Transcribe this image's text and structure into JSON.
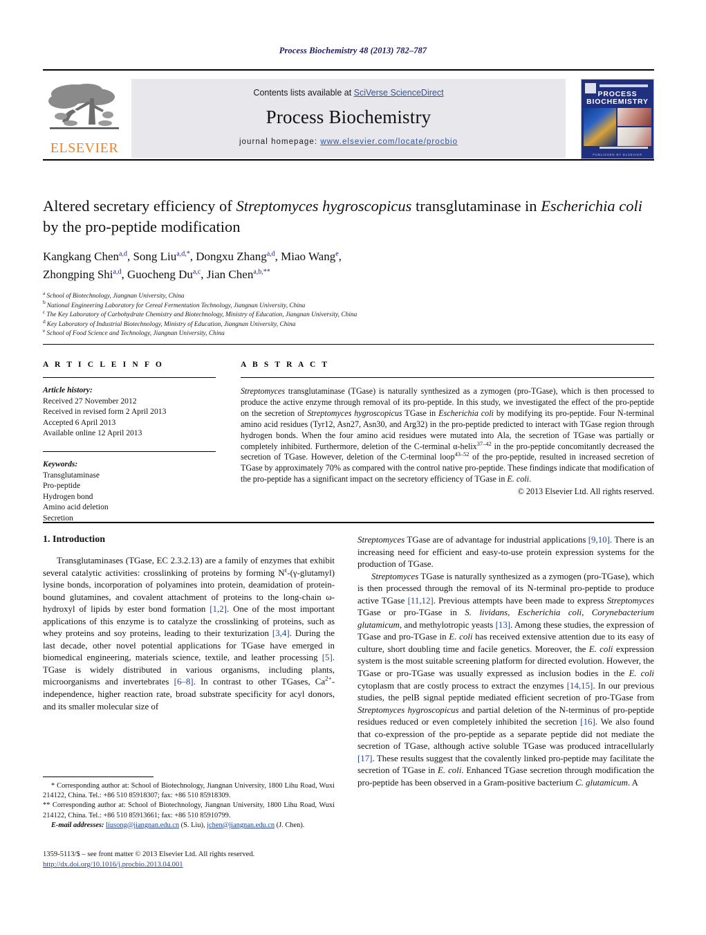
{
  "running_head": "Process Biochemistry 48 (2013) 782–787",
  "masthead": {
    "contents_prefix": "Contents lists available at ",
    "contents_link": "SciVerse ScienceDirect",
    "journal_title": "Process Biochemistry",
    "homepage_prefix": "journal homepage: ",
    "homepage_url": "www.elsevier.com/locate/procbio",
    "publisher_wordmark": "ELSEVIER",
    "cover_title": "PROCESS BIOCHEMISTRY",
    "cover_footer": "PUBLISHED BY ELSEVIER",
    "link_color": "#2e54a1",
    "band_color": "#e8e8ec",
    "elsevier_orange": "#f58220",
    "cover_blue": "#21307e"
  },
  "article": {
    "title_line1_a": "Altered secretary efficiency of ",
    "title_line1_i": "Streptomyces hygroscopicus",
    "title_line1_b": " transglutaminase in",
    "title_line2_i": "Escherichia coli",
    "title_line2_b": " by the pro-peptide modification",
    "authors": [
      {
        "name": "Kangkang Chen",
        "sup": "a,d",
        "sep": ", "
      },
      {
        "name": "Song Liu",
        "sup": "a,d,*",
        "sep": ", "
      },
      {
        "name": "Dongxu Zhang",
        "sup": "a,d",
        "sep": ", "
      },
      {
        "name": "Miao Wang",
        "sup": "e",
        "sep": ","
      },
      {
        "name": "Zhongping Shi",
        "sup": "a,d",
        "sep": ", "
      },
      {
        "name": "Guocheng Du",
        "sup": "a,c",
        "sep": ", "
      },
      {
        "name": "Jian Chen",
        "sup": "a,b,**",
        "sep": ""
      }
    ],
    "affiliations": [
      {
        "mark": "a",
        "text": "School of Biotechnology, Jiangnan University, China"
      },
      {
        "mark": "b",
        "text": "National Engineering Laboratory for Cereal Fermentation Technology, Jiangnan University, China"
      },
      {
        "mark": "c",
        "text": "The Key Laboratory of Carbohydrate Chemistry and Biotechnology, Ministry of Education, Jiangnan University, China"
      },
      {
        "mark": "d",
        "text": "Key Laboratory of Industrial Biotechnology, Ministry of Education, Jiangnan University, China"
      },
      {
        "mark": "e",
        "text": "School of Food Science and Technology, Jiangnan University, China"
      }
    ]
  },
  "article_info": {
    "heading": "A R T I C L E   I N F O",
    "history_label": "Article history:",
    "history": [
      "Received 27 November 2012",
      "Received in revised form 2 April 2013",
      "Accepted 6 April 2013",
      "Available online 12 April 2013"
    ],
    "keywords_label": "Keywords:",
    "keywords": [
      "Transglutaminase",
      "Pro-peptide",
      "Hydrogen bond",
      "Amino acid deletion",
      "Secretion"
    ]
  },
  "abstract": {
    "heading": "A B S T R A C T",
    "p1_i1": "Streptomyces",
    "p1_t1": " transglutaminase (TGase) is naturally synthesized as a zymogen (pro-TGase), which is then processed to produce the active enzyme through removal of its pro-peptide. In this study, we investigated the effect of the pro-peptide on the secretion of ",
    "p1_i2": "Streptomyces hygroscopicus",
    "p1_t2": " TGase in ",
    "p1_i3": "Escherichia coli",
    "p1_t3": " by modifying its pro-peptide. Four N-terminal amino acid residues (Tyr12, Asn27, Asn30, and Arg32) in the pro-peptide predicted to interact with TGase region through hydrogen bonds. When the four amino acid residues were mutated into Ala, the secretion of TGase was partially or completely inhibited. Furthermore, deletion of the C-terminal α-helix",
    "p1_sup1": "37–42",
    "p1_t4": " in the pro-peptide concomitantly decreased the secretion of TGase. However, deletion of the C-terminal loop",
    "p1_sup2": "43–52",
    "p1_t5": " of the pro-peptide, resulted in increased secretion of TGase by approximately 70% as compared with the control native pro-peptide. These findings indicate that modification of the pro-peptide has a significant impact on the secretory efficiency of TGase in ",
    "p1_i4": "E. coli",
    "p1_t6": ".",
    "copyright": "© 2013 Elsevier Ltd. All rights reserved."
  },
  "introduction": {
    "heading": "1.  Introduction",
    "left_p1_a": "Transglutaminases (TGase, EC 2.3.2.13) are a family of enzymes that exhibit several catalytic activities: crosslinking of proteins by forming N",
    "left_p1_sup": "ε",
    "left_p1_b": "-(γ-glutamyl) lysine bonds, incorporation of polyamines into protein, deamidation of protein-bound glutamines, and covalent attachment of proteins to the long-chain ω-hydroxyl of lipids by ester bond formation ",
    "left_ref_12": "[1,2]",
    "left_p1_c": ". One of the most important applications of this enzyme is to catalyze the crosslinking of proteins, such as whey proteins and soy proteins, leading to their texturization ",
    "left_ref_34": "[3,4]",
    "left_p1_d": ". During the last decade, other novel potential applications for TGase have emerged in biomedical engineering, materials science, textile, and leather processing ",
    "left_ref_5": "[5]",
    "left_p1_e": ". TGase is widely distributed in various organisms, including plants, microorganisms and invertebrates ",
    "left_ref_68": "[6–8]",
    "left_p1_f": ". In contrast to other TGases, Ca",
    "left_p1_sup2": "2+",
    "left_p1_g": "-independence, higher reaction rate, broad substrate specificity for acyl donors, and its smaller molecular size of",
    "right_p1_i": "Streptomyces",
    "right_p1_a": " TGase are of advantage for industrial applications ",
    "right_ref_910": "[9,10]",
    "right_p1_b": ". There is an increasing need for efficient and easy-to-use protein expression systems for the production of TGase.",
    "right_p2_i1": "Streptomyces",
    "right_p2_a": " TGase is naturally synthesized as a zymogen (pro-TGase), which is then processed through the removal of its N-terminal pro-peptide to produce active TGase ",
    "right_ref_1112": "[11,12]",
    "right_p2_b": ". Previous attempts have been made to express ",
    "right_p2_i2": "Streptomyces",
    "right_p2_c": " TGase or pro-TGase in ",
    "right_p2_i3": "S. lividans, Escherichia coli, Corynebacterium glutamicum",
    "right_p2_d": ", and methylotropic yeasts ",
    "right_ref_13": "[13]",
    "right_p2_e": ". Among these studies, the expression of TGase and pro-TGase in ",
    "right_p2_i4": "E. coli",
    "right_p2_f": " has received extensive attention due to its easy of culture, short doubling time and facile genetics. Moreover, the ",
    "right_p2_i5": "E. coli",
    "right_p2_g": " expression system is the most suitable screening platform for directed evolution. However, the TGase or pro-TGase was usually expressed as inclusion bodies in the ",
    "right_p2_i6": "E. coli",
    "right_p2_h": " cytoplasm that are costly process to extract the enzymes ",
    "right_ref_1415": "[14,15]",
    "right_p2_i": ". In our previous studies, the pelB signal peptide mediated efficient secretion of pro-TGase from ",
    "right_p2_i7": "Streptomyces hygroscopicus",
    "right_p2_j": " and partial deletion of the N-terminus of pro-peptide residues reduced or even completely inhibited the secretion ",
    "right_ref_16": "[16]",
    "right_p2_k": ". We also found that co-expression of the pro-peptide as a separate peptide did not mediate the secretion of TGase, although active soluble TGase was produced intracellularly ",
    "right_ref_17": "[17]",
    "right_p2_l": ". These results suggest that the covalently linked pro-peptide may facilitate the secretion of TGase in ",
    "right_p2_i8": "E. coli",
    "right_p2_m": ". Enhanced TGase secretion through modification the pro-peptide has been observed in a Gram-positive bacterium ",
    "right_p2_i9": "C. glutamicum",
    "right_p2_n": ". A"
  },
  "footnotes": {
    "fn1": "*  Corresponding author at: School of Biotechnology, Jiangnan University, 1800 Lihu Road, Wuxi 214122, China. Tel.: +86 510 85918307; fax: +86 510 85918309.",
    "fn2": "**  Corresponding author at: School of Biotechnology, Jiangnan University, 1800 Lihu Road, Wuxi 214122, China. Tel.: +86 510 85913661; fax: +86 510 85910799.",
    "email_label": "E-mail addresses:",
    "email1": "liusong@jiangnan.edu.cn",
    "email1_owner": " (S. Liu), ",
    "email2": "jchen@jiangnan.edu.cn",
    "email2_owner": "(J. Chen)."
  },
  "imprint": {
    "issn_line": "1359-5113/$ – see front matter © 2013 Elsevier Ltd. All rights reserved.",
    "doi": "http://dx.doi.org/10.1016/j.procbio.2013.04.001"
  }
}
